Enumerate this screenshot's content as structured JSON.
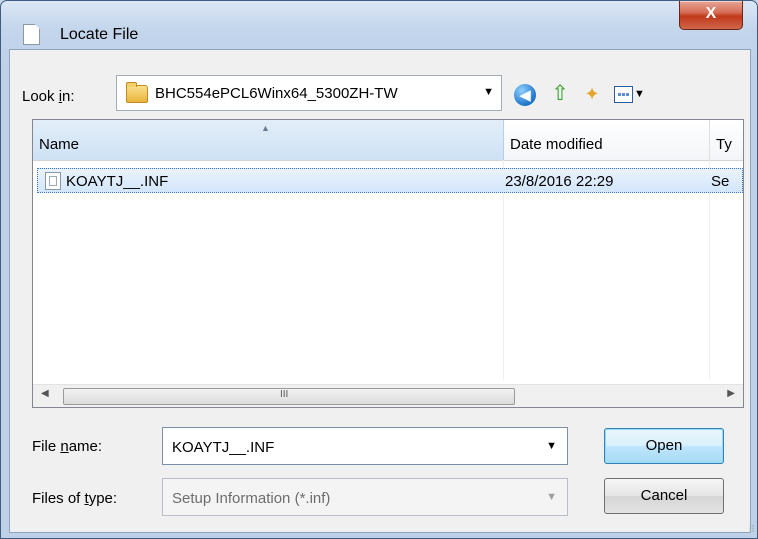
{
  "window": {
    "title": "Locate File",
    "close_label": "X"
  },
  "toolbar": {
    "lookin_label_pre": "Look ",
    "lookin_label_key": "i",
    "lookin_label_post": "n:",
    "lookin_value": "BHC554ePCL6Winx64_5300ZH-TW",
    "icons": [
      "folder-icon",
      "back-icon",
      "up-folder-icon",
      "new-folder-icon",
      "views-menu-icon"
    ]
  },
  "list": {
    "columns": {
      "name": "Name",
      "date": "Date modified",
      "type": "Ty"
    },
    "rows": [
      {
        "name": "KOAYTJ__.INF",
        "date": "23/8/2016 22:29",
        "type": "Se"
      }
    ],
    "scroll_grip": "III"
  },
  "form": {
    "filename_label_pre": "File ",
    "filename_label_key": "n",
    "filename_label_post": "ame:",
    "filename_value": "KOAYTJ__.INF",
    "filetype_label_pre": "Files of ",
    "filetype_label_key": "t",
    "filetype_label_post": "ype:",
    "filetype_value": "Setup Information (*.inf)"
  },
  "buttons": {
    "open": "Open",
    "cancel": "Cancel"
  },
  "colors": {
    "selection": "#d3e6fb",
    "title_close": "#c0391b",
    "open_button": "#bee6fd"
  }
}
